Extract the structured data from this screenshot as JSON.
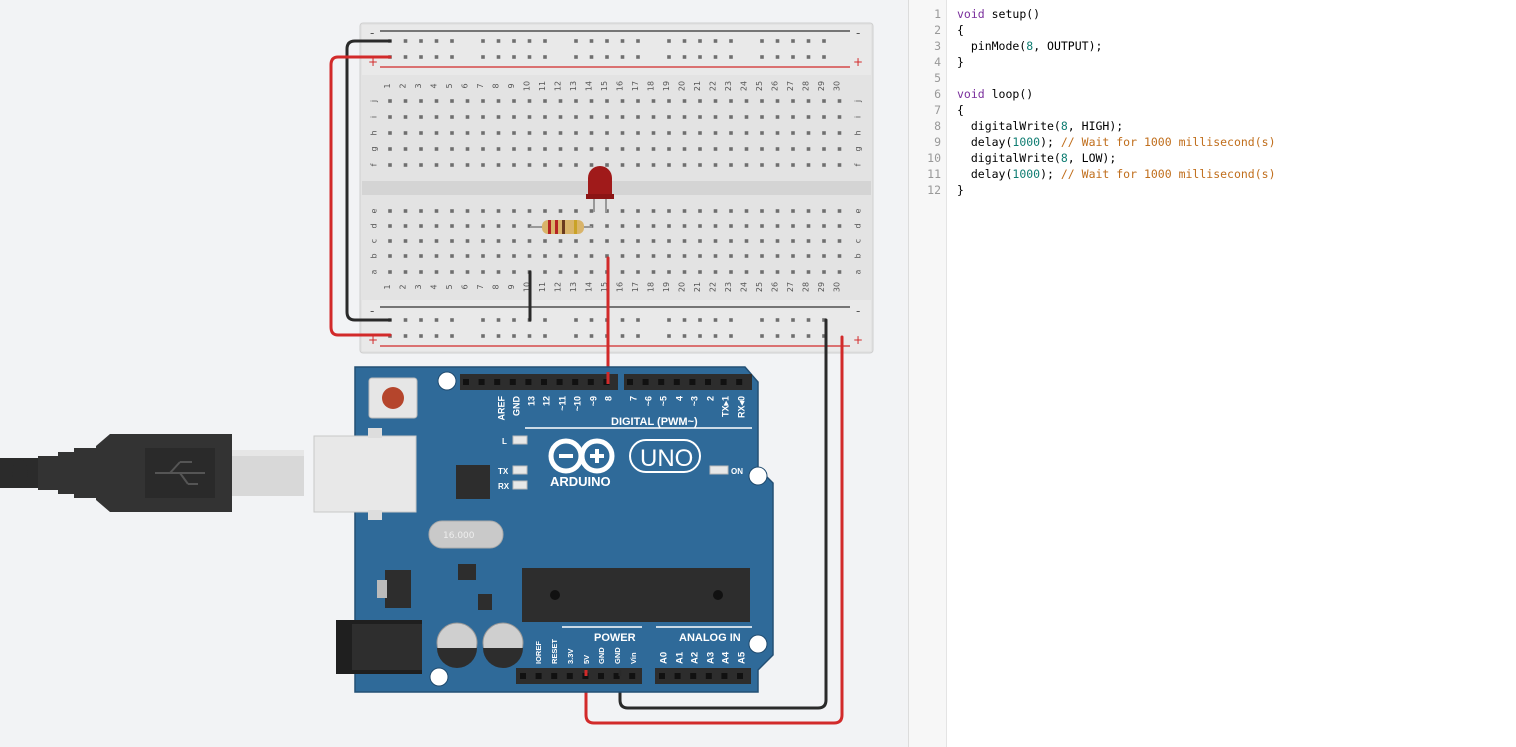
{
  "breadboard": {
    "columns": [
      "1",
      "2",
      "3",
      "4",
      "5",
      "6",
      "7",
      "8",
      "9",
      "10",
      "11",
      "12",
      "13",
      "14",
      "15",
      "16",
      "17",
      "18",
      "19",
      "20",
      "21",
      "22",
      "23",
      "24",
      "25",
      "26",
      "27",
      "28",
      "29",
      "30"
    ],
    "rows_top": [
      "j",
      "i",
      "h",
      "g",
      "f"
    ],
    "rows_bottom": [
      "e",
      "d",
      "c",
      "b",
      "a"
    ],
    "rail_minus": "-",
    "rail_plus": "+"
  },
  "arduino": {
    "logo_text": "ARDUINO",
    "model": "UNO",
    "digital_label": "DIGITAL (PWM~)",
    "power_label": "POWER",
    "analog_label": "ANALOG IN",
    "led_l": "L",
    "led_tx": "TX",
    "led_rx": "RX",
    "led_on": "ON",
    "crystal": "16.000",
    "digital_pins": [
      "AREF",
      "GND",
      "13",
      "12",
      "~11",
      "~10",
      "~9",
      "8",
      "7",
      "~6",
      "~5",
      "4",
      "~3",
      "2",
      "TX▸1",
      "RX◂0"
    ],
    "power_pins": [
      "IOREF",
      "RESET",
      "3.3V",
      "5V",
      "GND",
      "GND",
      "Vin"
    ],
    "analog_pins": [
      "A0",
      "A1",
      "A2",
      "A3",
      "A4",
      "A5"
    ]
  },
  "colors": {
    "board_blue": "#2f6a99",
    "wire_red": "#d22a2a",
    "wire_black": "#2a2a2a",
    "led_red": "#a01a1a",
    "code_keyword": "#7a2f9c",
    "code_number": "#0f7d72",
    "code_comment": "#c06e1c"
  },
  "editor": {
    "line_numbers": [
      "1",
      "2",
      "3",
      "4",
      "5",
      "6",
      "7",
      "8",
      "9",
      "10",
      "11",
      "12"
    ],
    "lines": [
      "void setup()",
      "{",
      "  pinMode(8, OUTPUT);",
      "}",
      "",
      "void loop()",
      "{",
      "  digitalWrite(8, HIGH);",
      "  delay(1000); // Wait for 1000 millisecond(s)",
      "  digitalWrite(8, LOW);",
      "  delay(1000); // Wait for 1000 millisecond(s)",
      "}"
    ]
  }
}
